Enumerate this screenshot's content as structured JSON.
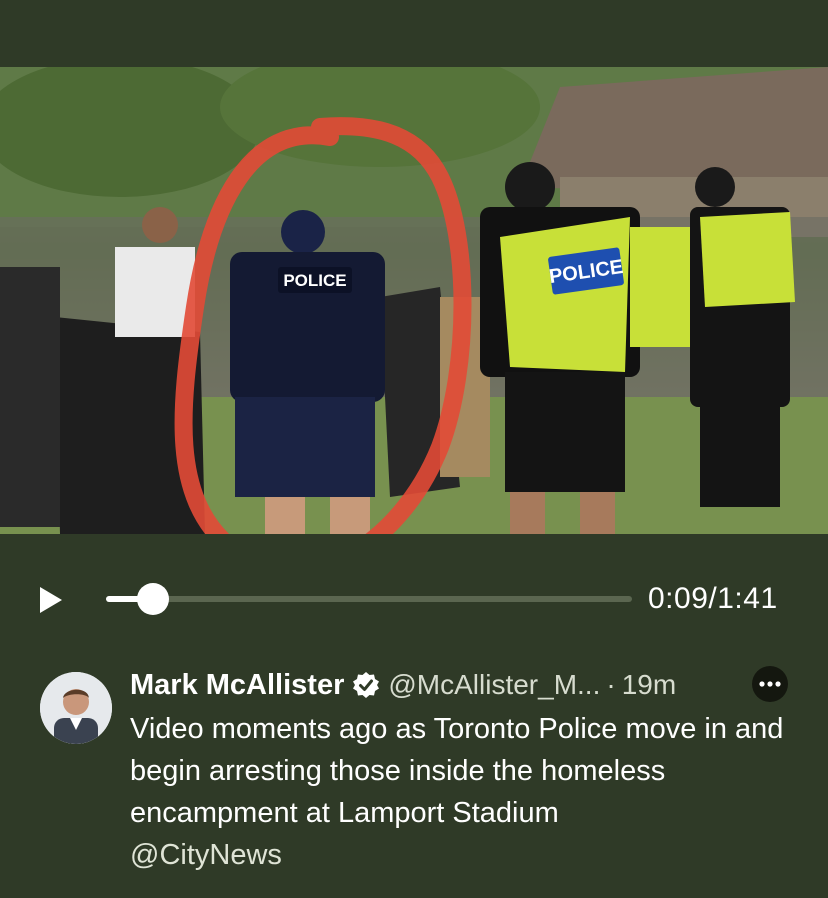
{
  "video": {
    "vest_label_left": "POLICE",
    "vest_label_right": "POLICE"
  },
  "player": {
    "elapsed": "0:09",
    "separator": "/",
    "duration": "1:41",
    "progress_fraction": 0.089
  },
  "tweet": {
    "author_name": "Mark McAllister",
    "handle": "@McAllister_M...",
    "dot": "·",
    "time_ago": "19m",
    "text": "Video moments ago as Toronto Police move in and begin arresting those inside the homeless encampment at Lamport Stadium",
    "mention": "@CityNews"
  },
  "icons": {
    "play": "play-icon",
    "verified": "verified-badge-icon",
    "more": "more-options-icon"
  },
  "colors": {
    "background": "#2f3a27",
    "annotation_circle": "#e24a36",
    "police_vest": "#c8e038"
  }
}
